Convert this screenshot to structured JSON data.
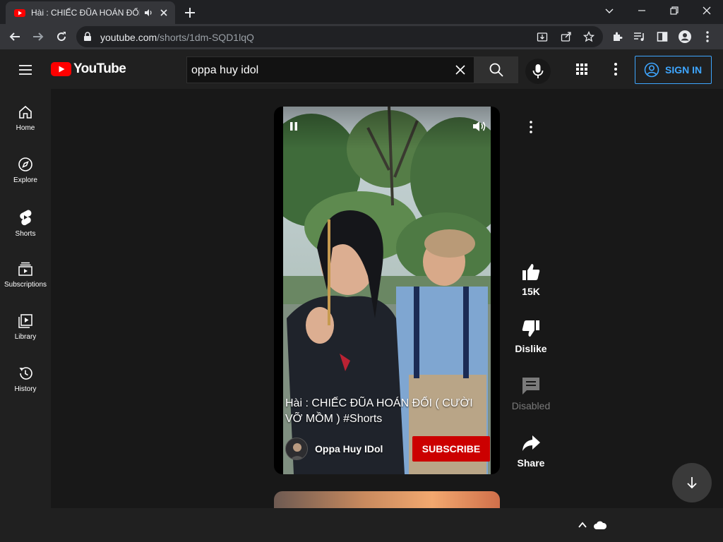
{
  "browser": {
    "tab_title": "Hài : CHIẾC ĐŨA HOÁN ĐỔI",
    "url_host": "youtube.com",
    "url_path": "/shorts/1dm-SQD1lqQ"
  },
  "masthead": {
    "logo_text": "YouTube",
    "search_query": "oppa huy idol",
    "sign_in_label": "SIGN IN"
  },
  "sidebar": {
    "items": [
      {
        "label": "Home",
        "icon": "home-icon"
      },
      {
        "label": "Explore",
        "icon": "compass-icon"
      },
      {
        "label": "Shorts",
        "icon": "shorts-icon"
      },
      {
        "label": "Subscriptions",
        "icon": "subscriptions-icon"
      },
      {
        "label": "Library",
        "icon": "library-icon"
      },
      {
        "label": "History",
        "icon": "history-icon"
      }
    ]
  },
  "short": {
    "title": "Hài : CHIẾC ĐŨA HOÁN ĐỔI ( CƯỜI VỠ MỒM ) #Shorts",
    "channel": "Oppa Huy IDol",
    "subscribe_label": "SUBSCRIBE",
    "like_count": "15K",
    "dislike_label": "Dislike",
    "comments_label": "Disabled",
    "share_label": "Share"
  },
  "colors": {
    "accent_blue": "#3ea6ff",
    "subscribe_red": "#cc0000",
    "youtube_red": "#ff0000"
  }
}
